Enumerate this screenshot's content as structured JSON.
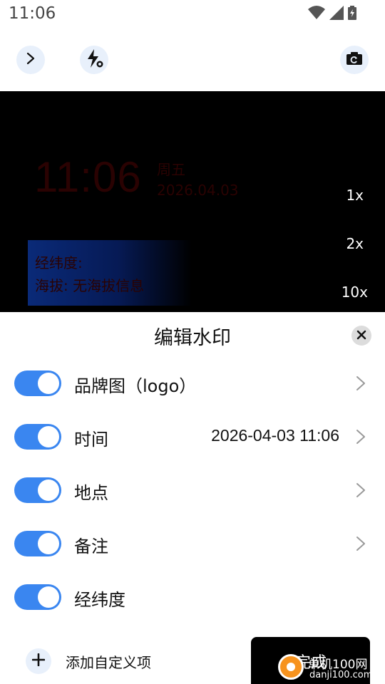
{
  "status_bar": {
    "time": "11:06",
    "icons": [
      "wifi-icon",
      "cell-signal-icon",
      "battery-icon"
    ]
  },
  "toolbar": {
    "icons": [
      "chevron-right-icon",
      "flash-auto-icon",
      "camera-switch-icon"
    ]
  },
  "preview": {
    "watermark": {
      "time": "11:06",
      "day": "周五",
      "date": "2026.04.03",
      "latlong_label": "经纬度:",
      "altitude": "海拔: 无海拔信息"
    },
    "zoom_levels": [
      "1x",
      "2x",
      "10x"
    ]
  },
  "sheet": {
    "title": "编辑水印",
    "rows": [
      {
        "label": "品牌图（logo）",
        "value": "",
        "enabled": true,
        "has_chevron": true
      },
      {
        "label": "时间",
        "value": "2026-04-03 11:06",
        "enabled": true,
        "has_chevron": true
      },
      {
        "label": "地点",
        "value": "",
        "enabled": true,
        "has_chevron": true
      },
      {
        "label": "备注",
        "value": "",
        "enabled": true,
        "has_chevron": true
      },
      {
        "label": "经纬度",
        "value": "",
        "enabled": true,
        "has_chevron": false
      }
    ],
    "add_custom": "添加自定义项",
    "done": "完成"
  },
  "brand_overlay": {
    "name": "单机100网",
    "url": "danji100.com"
  },
  "colors": {
    "accent": "#3a86f0",
    "icon_bg": "#e8f0fb",
    "watermark_text": "#2a0202",
    "watermark_panel": "#0a2a78"
  }
}
